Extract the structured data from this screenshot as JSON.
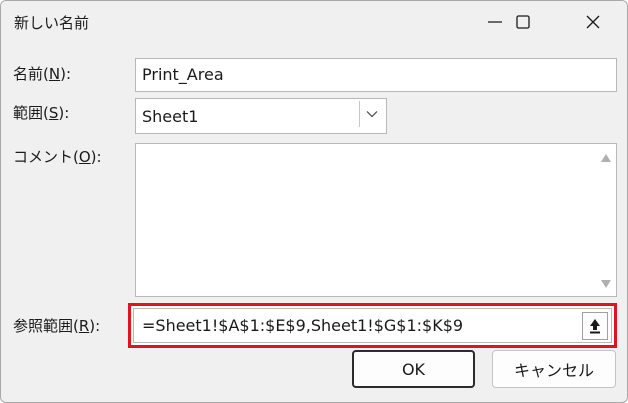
{
  "window": {
    "title": "新しい名前"
  },
  "form": {
    "name_label_prefix": "名前(",
    "name_label_key": "N",
    "name_label_suffix": "):",
    "name_value": "Print_Area",
    "scope_label_prefix": "範囲(",
    "scope_label_key": "S",
    "scope_label_suffix": "):",
    "scope_value": "Sheet1",
    "comment_label_prefix": "コメント(",
    "comment_label_key": "O",
    "comment_label_suffix": "):",
    "comment_value": "",
    "ref_label_prefix": "参照範囲(",
    "ref_label_key": "R",
    "ref_label_suffix": "):",
    "ref_value": "=Sheet1!$A$1:$E$9,Sheet1!$G$1:$K$9"
  },
  "buttons": {
    "ok": "OK",
    "cancel": "キャンセル"
  },
  "icons": {
    "minimize": "minimize-icon",
    "maximize": "maximize-icon",
    "close": "close-icon",
    "dropdown": "chevron-down-icon",
    "collapse": "collapse-dialog-icon"
  },
  "colors": {
    "highlight": "#e0141e",
    "dialog_bg": "#f0f0f0"
  }
}
